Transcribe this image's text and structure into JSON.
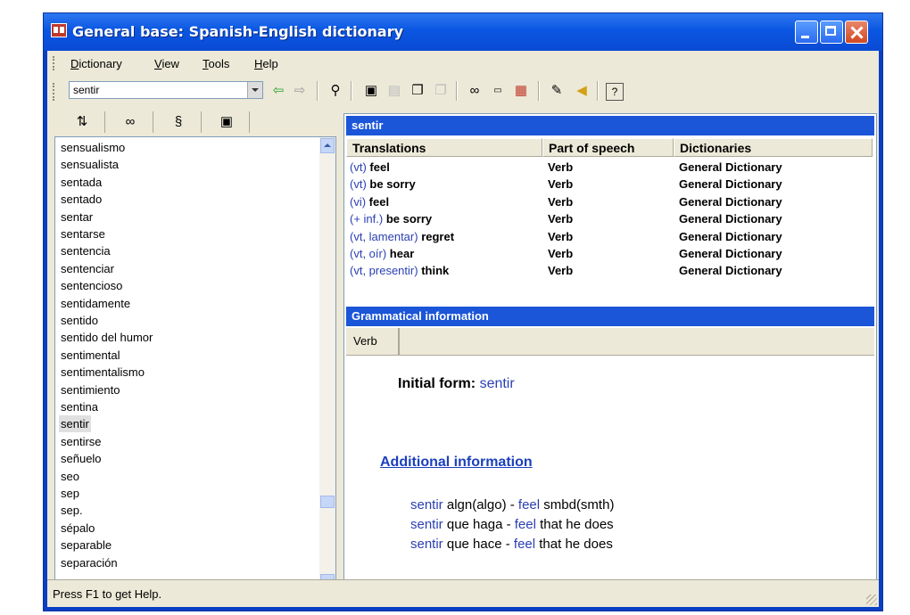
{
  "window": {
    "title": "General base: Spanish-English dictionary"
  },
  "menu": [
    {
      "label": "Dictionary",
      "key": "D",
      "rest": "ictionary"
    },
    {
      "label": "View",
      "key": "V",
      "rest": "iew"
    },
    {
      "label": "Tools",
      "key": "T",
      "rest": "ools"
    },
    {
      "label": "Help",
      "key": "H",
      "rest": "elp"
    }
  ],
  "search": {
    "value": "sentir"
  },
  "toolbar_icons": [
    "back-arrow-icon",
    "forward-arrow-icon",
    "find-icon",
    "clipboard-icon",
    "paste-icon",
    "copy-icon",
    "copy-disabled-icon",
    "glasses-icon",
    "ed-icon",
    "dictionary-icon",
    "pin-icon",
    "speaker-icon",
    "help-icon"
  ],
  "left_tabs": [
    "sort-az-icon",
    "binoculars-icon",
    "phrase-icon",
    "clipboard-icon"
  ],
  "word_list": {
    "selected": "sentir",
    "items": [
      "sensualismo",
      "sensualista",
      "sentada",
      "sentado",
      "sentar",
      "sentarse",
      "sentencia",
      "sentenciar",
      "sentencioso",
      "sentidamente",
      "sentido",
      "sentido del humor",
      "sentimental",
      "sentimentalismo",
      "sentimiento",
      "sentina",
      "sentir",
      "sentirse",
      "señuelo",
      "seo",
      "sep",
      "sep.",
      "sépalo",
      "separable",
      "separación"
    ]
  },
  "headword": "sentir",
  "translations": {
    "columns": [
      "Translations",
      "Part of speech",
      "Dictionaries"
    ],
    "rows": [
      {
        "gram": "(vt)",
        "word": "feel",
        "pos": "Verb",
        "dict": "General Dictionary"
      },
      {
        "gram": "(vt)",
        "word": "be sorry",
        "pos": "Verb",
        "dict": "General Dictionary"
      },
      {
        "gram": "(vi)",
        "word": "feel",
        "pos": "Verb",
        "dict": "General Dictionary"
      },
      {
        "gram": "(+ inf.)",
        "word": "be sorry",
        "pos": "Verb",
        "dict": "General Dictionary"
      },
      {
        "gram": "(vt, lamentar)",
        "word": "regret",
        "pos": "Verb",
        "dict": "General Dictionary"
      },
      {
        "gram": "(vt, oír)",
        "word": "hear",
        "pos": "Verb",
        "dict": "General Dictionary"
      },
      {
        "gram": "(vt, presentir)",
        "word": "think",
        "pos": "Verb",
        "dict": "General Dictionary"
      }
    ]
  },
  "grammar": {
    "header": "Grammatical information",
    "tab": "Verb",
    "initial_label": "Initial form:",
    "initial_value": "sentir",
    "additional_title": "Additional information",
    "examples": [
      {
        "a": "sentir",
        "b": " algn(algo) - ",
        "c": "feel",
        "d": " smbd(smth)"
      },
      {
        "a": "sentir",
        "b": " que haga - ",
        "c": "feel",
        "d": " that he does"
      },
      {
        "a": "sentir",
        "b": " que hace - ",
        "c": "feel",
        "d": " that he does"
      }
    ]
  },
  "status": "Press F1 to get Help."
}
